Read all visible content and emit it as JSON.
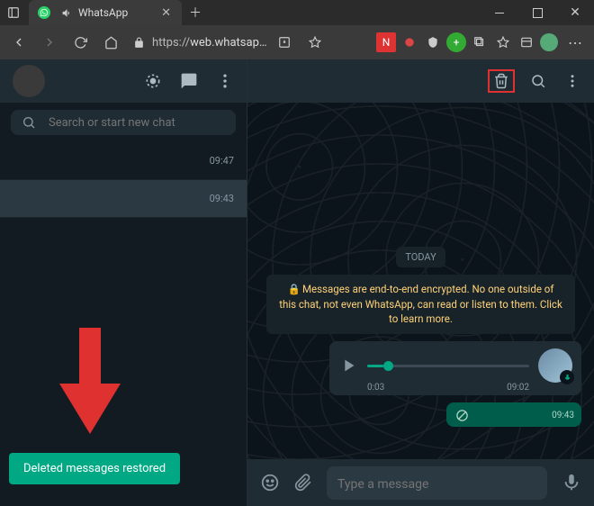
{
  "browser": {
    "tab_title": "WhatsApp",
    "url_protocol": "https://",
    "url_host": "web.whatsap…"
  },
  "sidebar": {
    "search_placeholder": "Search or start new chat",
    "chats": [
      {
        "time": "09:47"
      },
      {
        "time": "09:43"
      }
    ],
    "toast": "Deleted messages restored"
  },
  "chat": {
    "day_label": "TODAY",
    "encryption_notice": "Messages are end-to-end encrypted. No one outside of this chat, not even WhatsApp, can read or listen to them. Click to learn more.",
    "voice": {
      "elapsed": "0:03",
      "remaining": "09:02"
    },
    "deleted_time": "09:43",
    "input_placeholder": "Type a message"
  }
}
